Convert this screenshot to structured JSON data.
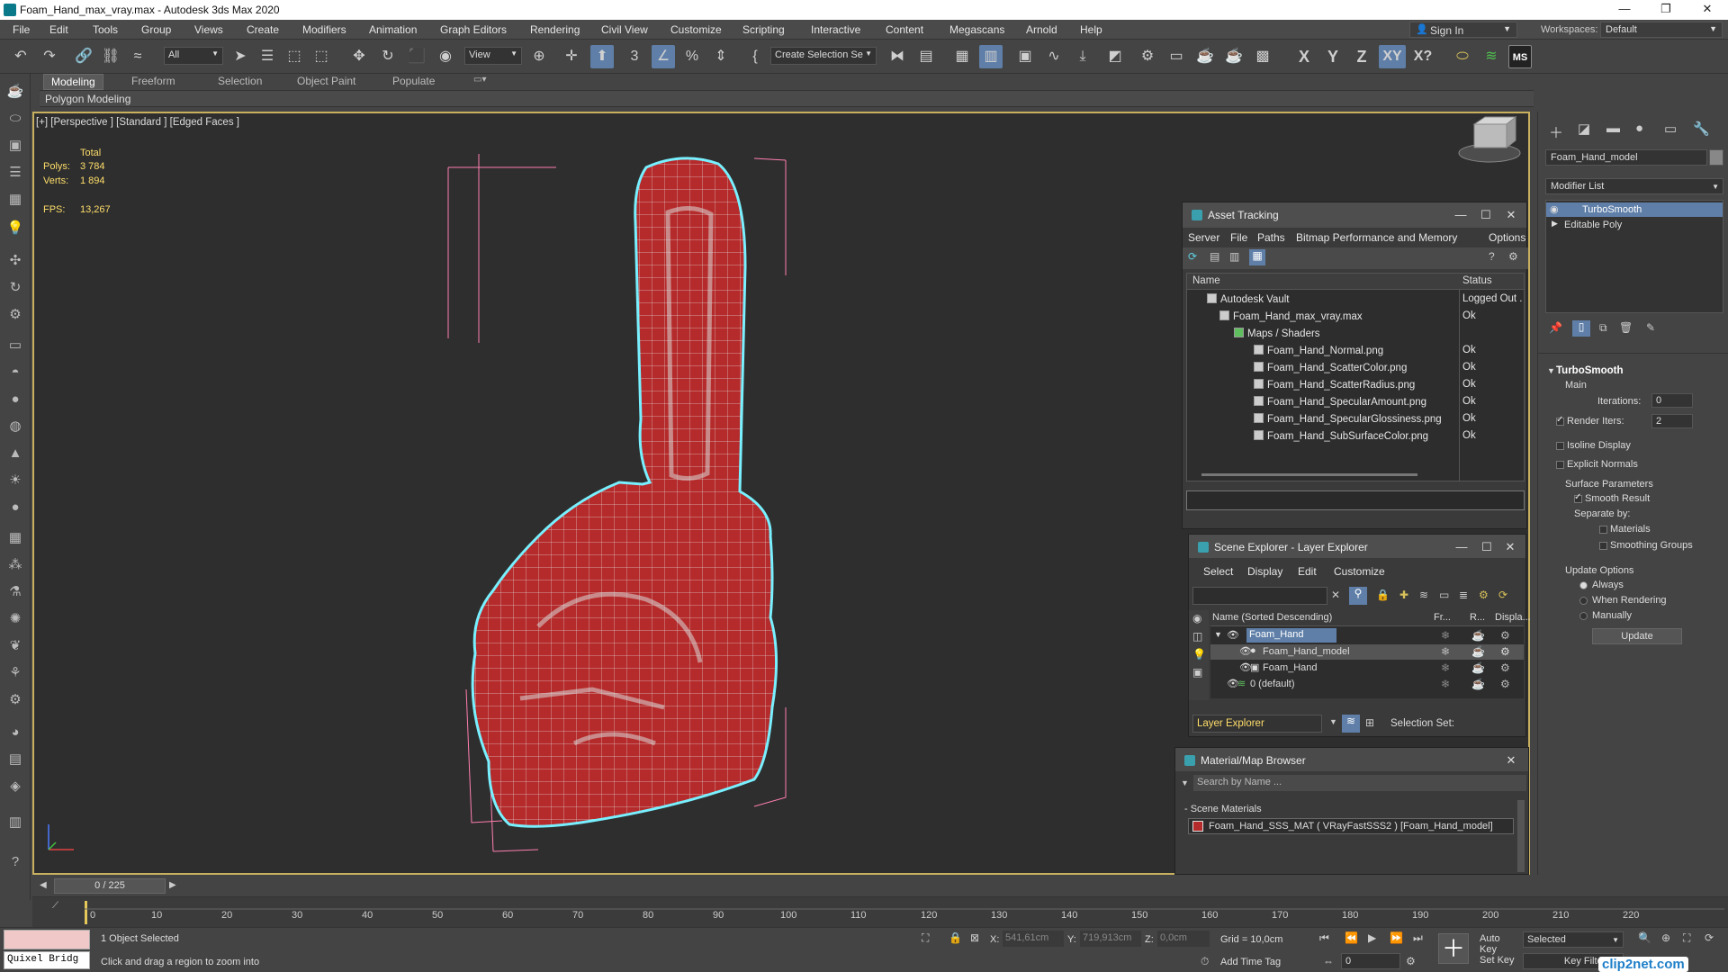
{
  "title": "Foam_Hand_max_vray.max - Autodesk 3ds Max 2020",
  "menu": [
    "File",
    "Edit",
    "Tools",
    "Group",
    "Views",
    "Create",
    "Modifiers",
    "Animation",
    "Graph Editors",
    "Rendering",
    "Civil View",
    "Customize",
    "Scripting",
    "Interactive",
    "Content",
    "Megascans",
    "Arnold",
    "Help"
  ],
  "signin": "Sign In",
  "workspaces_label": "Workspaces:",
  "workspaces_value": "Default",
  "toolbar": {
    "filter_value": "All",
    "refcoord_value": "View",
    "selection_set_placeholder": "Create Selection Se",
    "axes": [
      "X",
      "Y",
      "Z",
      "XY",
      "X?"
    ],
    "ms_label": "MS"
  },
  "ribbon": {
    "tabs": [
      "Modeling",
      "Freeform",
      "Selection",
      "Object Paint",
      "Populate"
    ],
    "active": "Modeling",
    "sub_label": "Polygon Modeling"
  },
  "viewport": {
    "label": "[+] [Perspective ] [Standard ] [Edged Faces ]",
    "stats": {
      "total_label": "Total",
      "polys_label": "Polys:",
      "polys_value": "3 784",
      "verts_label": "Verts:",
      "verts_value": "1 894",
      "fps_label": "FPS:",
      "fps_value": "13,267"
    }
  },
  "command_panel": {
    "object_name": "Foam_Hand_model",
    "modifier_list_label": "Modifier List",
    "stack": [
      "TurboSmooth",
      "Editable Poly"
    ],
    "rollout_title": "TurboSmooth",
    "main_label": "Main",
    "iterations_label": "Iterations:",
    "iterations_value": "0",
    "render_iters_label": "Render Iters:",
    "render_iters_value": "2",
    "isoline_label": "Isoline Display",
    "explicit_label": "Explicit Normals",
    "surface_params_label": "Surface Parameters",
    "smooth_result_label": "Smooth Result",
    "separate_by_label": "Separate by:",
    "materials_label": "Materials",
    "smoothing_groups_label": "Smoothing Groups",
    "update_options_label": "Update Options",
    "always_label": "Always",
    "when_rendering_label": "When Rendering",
    "manually_label": "Manually",
    "update_button": "Update"
  },
  "asset_tracking": {
    "title": "Asset Tracking",
    "menu": [
      "Server",
      "File",
      "Paths",
      "Bitmap Performance and Memory",
      "Options"
    ],
    "col_name": "Name",
    "col_status": "Status",
    "rows": [
      {
        "name": "Autodesk Vault",
        "status": "Logged Out ."
      },
      {
        "name": "Foam_Hand_max_vray.max",
        "status": "Ok"
      },
      {
        "name": "Maps / Shaders",
        "status": ""
      },
      {
        "name": "Foam_Hand_Normal.png",
        "status": "Ok"
      },
      {
        "name": "Foam_Hand_ScatterColor.png",
        "status": "Ok"
      },
      {
        "name": "Foam_Hand_ScatterRadius.png",
        "status": "Ok"
      },
      {
        "name": "Foam_Hand_SpecularAmount.png",
        "status": "Ok"
      },
      {
        "name": "Foam_Hand_SpecularGlossiness.png",
        "status": "Ok"
      },
      {
        "name": "Foam_Hand_SubSurfaceColor.png",
        "status": "Ok"
      }
    ]
  },
  "scene_explorer": {
    "title": "Scene Explorer - Layer Explorer",
    "menu": [
      "Select",
      "Display",
      "Edit",
      "Customize"
    ],
    "col_name": "Name (Sorted Descending)",
    "col_fr": "Fr...",
    "col_r": "R...",
    "col_disp": "Displa...",
    "rows": [
      "Foam_Hand",
      "Foam_Hand_model",
      "Foam_Hand",
      "0 (default)"
    ],
    "layer_explorer_label": "Layer Explorer",
    "selection_set_label": "Selection Set:"
  },
  "material_browser": {
    "title": "Material/Map Browser",
    "search_placeholder": "Search by Name ...",
    "group_label": "- Scene Materials",
    "material_entry": "Foam_Hand_SSS_MAT ( VRayFastSSS2 ) [Foam_Hand_model]"
  },
  "timeline": {
    "frame_label": "0 / 225",
    "ticks": [
      "10",
      "20",
      "30",
      "40",
      "50",
      "60",
      "70",
      "80",
      "90",
      "100",
      "110",
      "120",
      "130",
      "140",
      "150",
      "160",
      "170",
      "180",
      "190",
      "200",
      "210",
      "220"
    ],
    "start_tick": "0"
  },
  "status": {
    "selected": "1 Object Selected",
    "prompt": "Click and drag a region to zoom into",
    "quixel": "Quixel Bridg",
    "x_label": "X:",
    "x_value": "541,61cm",
    "y_label": "Y:",
    "y_value": "719,913cm",
    "z_label": "Z:",
    "z_value": "0,0cm",
    "grid": "Grid = 10,0cm",
    "add_time_tag": "Add Time Tag",
    "auto_key": "Auto Key",
    "set_key": "Set Key",
    "selected_dropdown": "Selected",
    "key_filters": "Key Filters...",
    "frame_value": "0",
    "watermark": "clip2net.com"
  },
  "colors": {
    "accent": "#5f7fa8",
    "viewport_border": "#c8b060",
    "selection": "#78f0ff",
    "foam_red": "#b52a2a"
  }
}
